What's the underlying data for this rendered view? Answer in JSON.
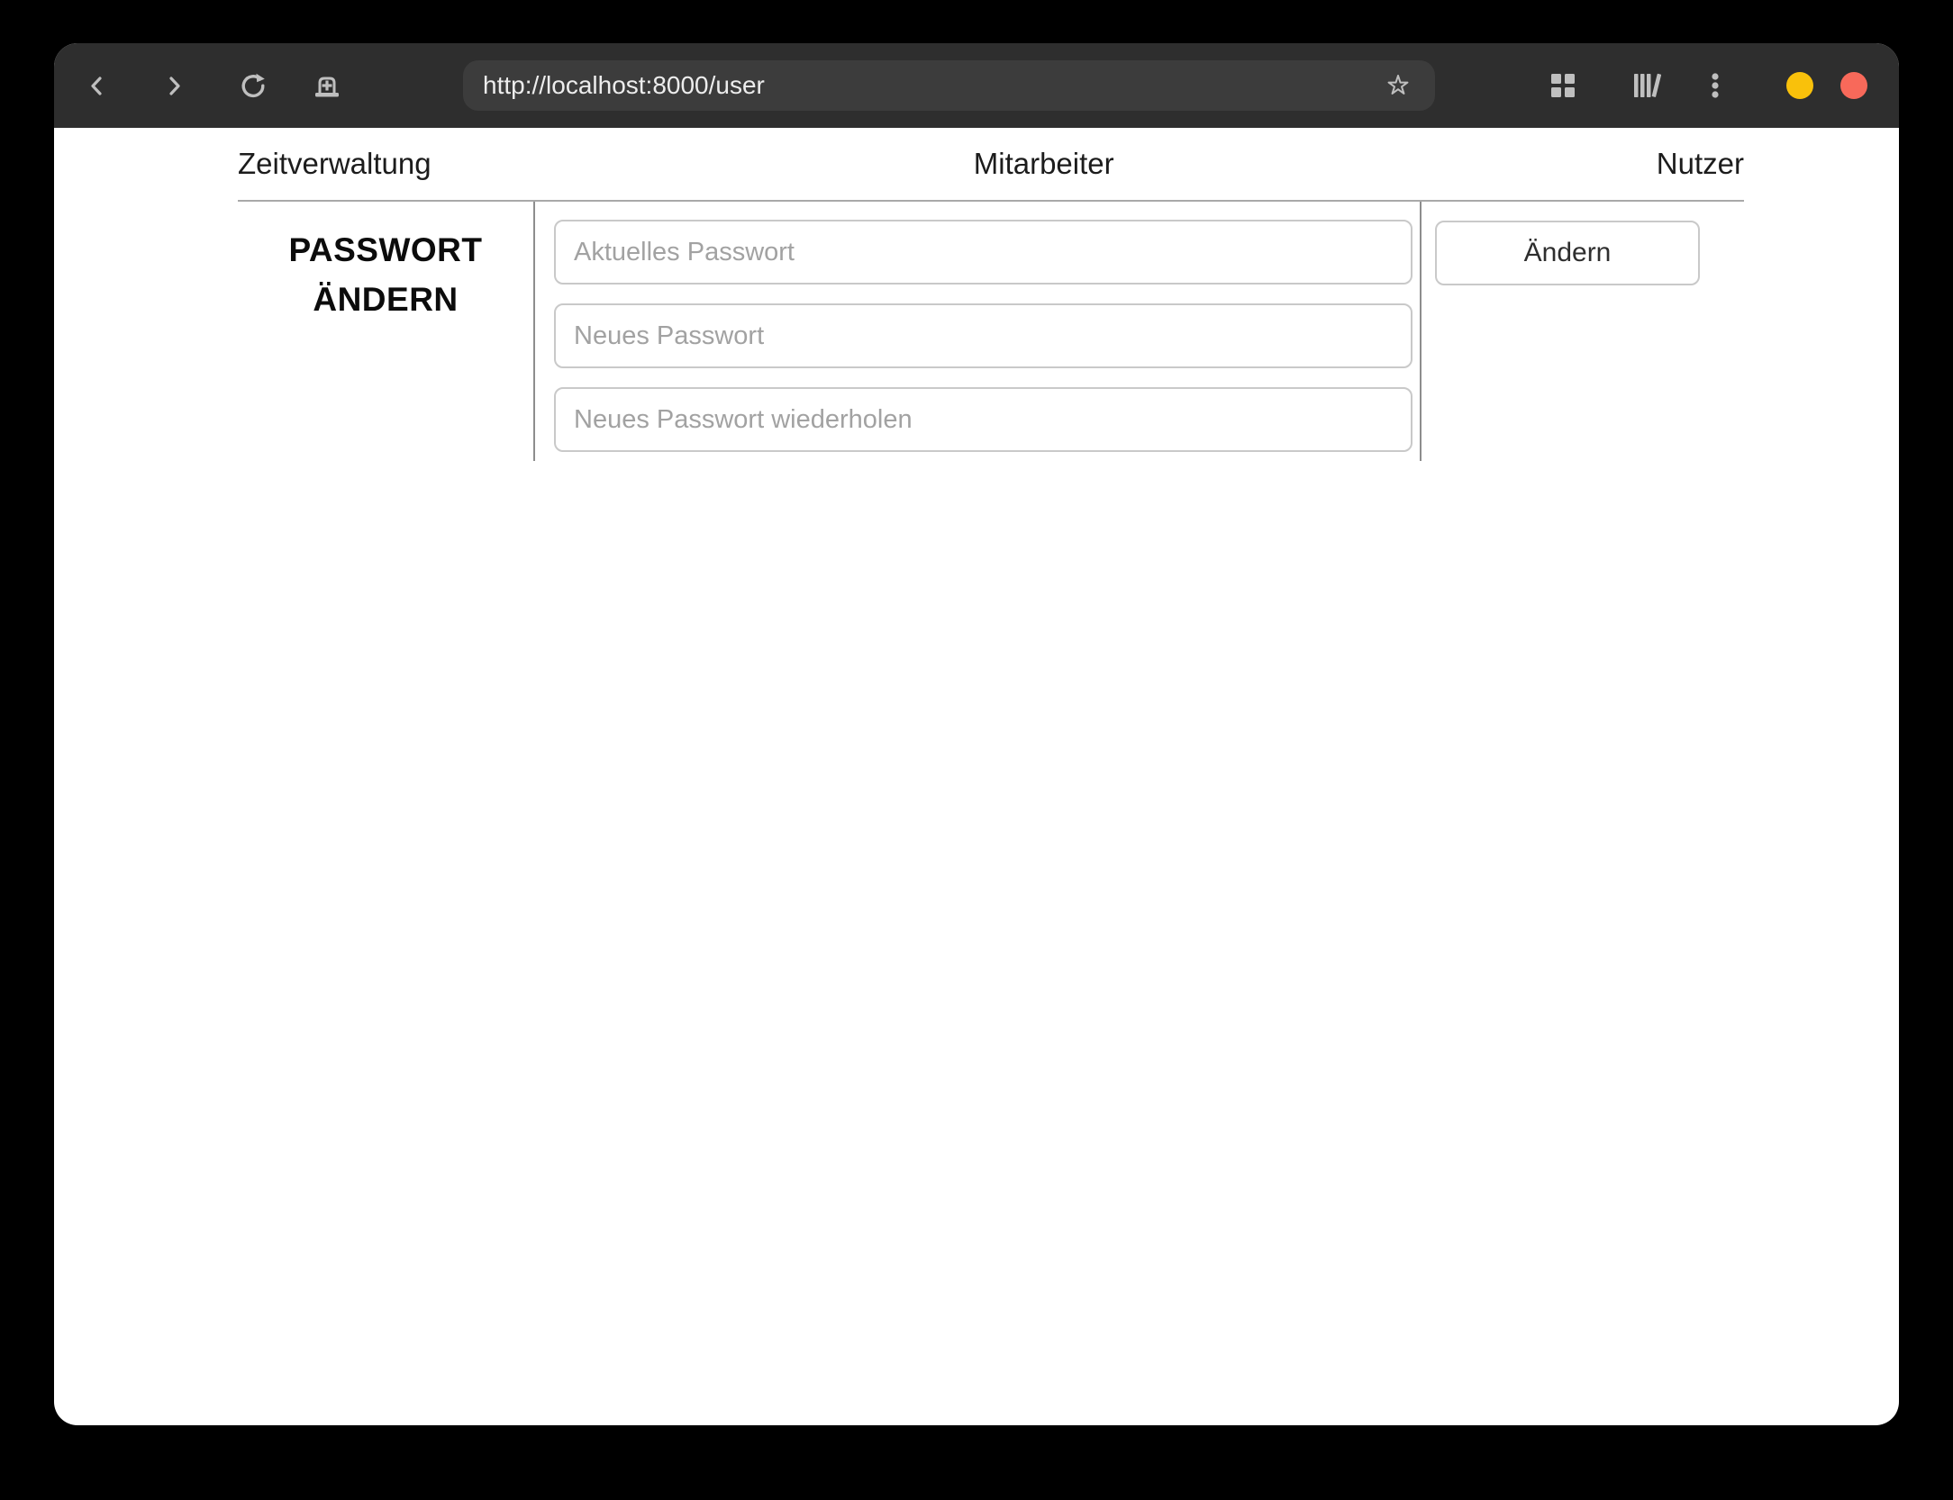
{
  "browser": {
    "url": "http://localhost:8000/user",
    "toolbar_colors": {
      "bg": "#2e2e2e",
      "urlbar_bg": "#3c3c3c",
      "icon_color": "#bfbfbf",
      "minimize_color": "#f9c10b",
      "close_color": "#f8695a"
    }
  },
  "nav": {
    "items": [
      {
        "label": "Zeitverwaltung"
      },
      {
        "label": "Mitarbeiter"
      },
      {
        "label": "Nutzer"
      }
    ]
  },
  "main": {
    "title_line1": "PASSWORT",
    "title_line2": "ÄNDERN",
    "fields": [
      {
        "placeholder": "Aktuelles Passwort",
        "value": ""
      },
      {
        "placeholder": "Neues Passwort",
        "value": ""
      },
      {
        "placeholder": "Neues Passwort wiederholen",
        "value": ""
      }
    ],
    "submit_label": "Ändern"
  }
}
